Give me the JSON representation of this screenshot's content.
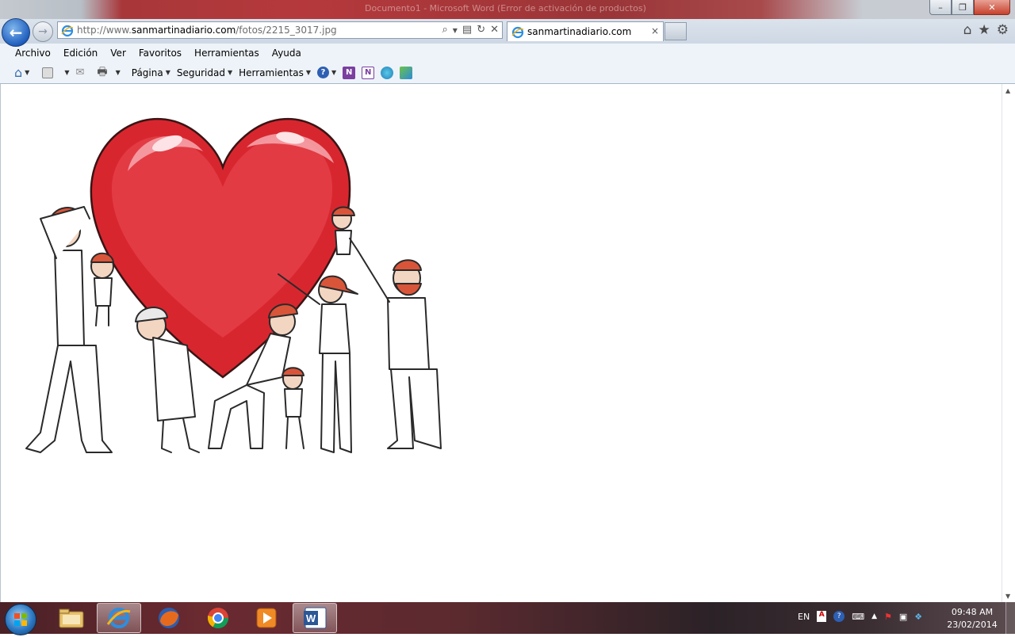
{
  "window": {
    "caption": "Documento1 - Microsoft Word (Error de activación de productos)",
    "minimize_label": "–",
    "restore_label": "❐",
    "close_label": "✕"
  },
  "nav": {
    "url_prefix": "http://www.",
    "url_domain": "sanmartinadiario.com",
    "url_path": "/fotos/2215_3017.jpg",
    "tab_title": "sanmartinadiario.com",
    "tab_close": "×"
  },
  "menu": [
    "Archivo",
    "Edición",
    "Ver",
    "Favoritos",
    "Herramientas",
    "Ayuda"
  ],
  "commandbar": {
    "pagina": "Página",
    "seguridad": "Seguridad",
    "herramientas": "Herramientas"
  },
  "taskbar": {
    "lang": "EN",
    "time": "09:48 AM",
    "date": "23/02/2014"
  },
  "colors": {
    "heart": "#d8262f",
    "heart_highlight": "#f6a2a8",
    "hair": "#d9553a",
    "accent_blue": "#1f5fbf"
  }
}
